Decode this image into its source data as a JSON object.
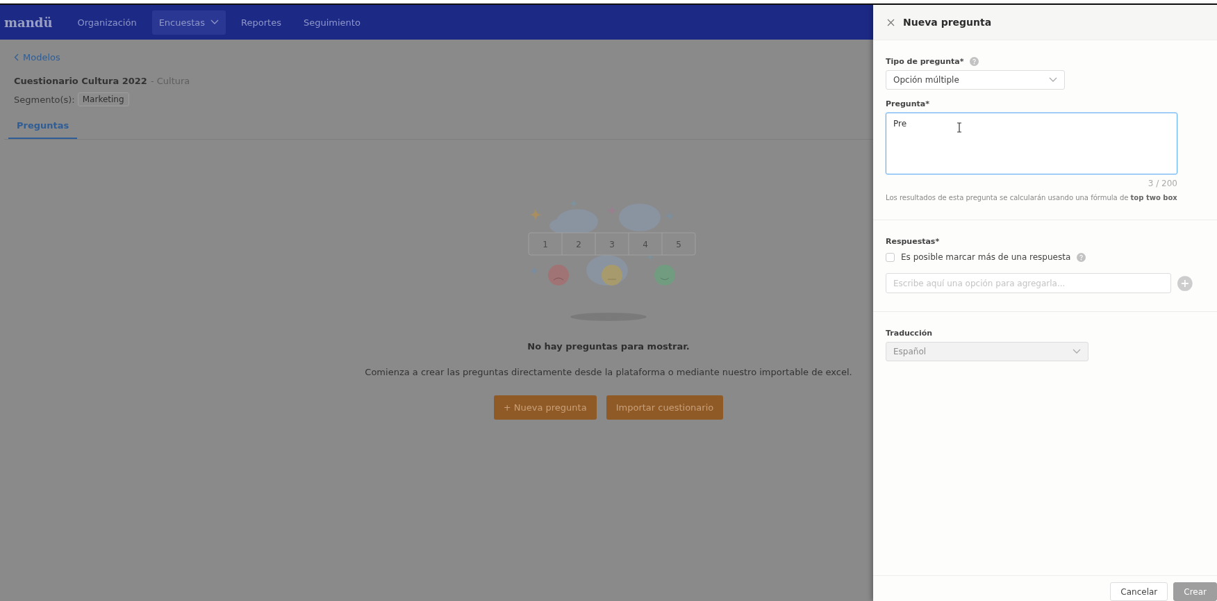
{
  "nav": {
    "logo": "mandü",
    "items": [
      {
        "label": "Organización",
        "kind": "link",
        "selected": false
      },
      {
        "label": "Encuestas",
        "kind": "dropdown",
        "selected": true
      },
      {
        "label": "Reportes",
        "kind": "link",
        "selected": false
      },
      {
        "label": "Seguimiento",
        "kind": "link",
        "selected": false
      }
    ]
  },
  "breadcrumb": "Modelos",
  "survey": {
    "title": "Cuestionario Cultura 2022",
    "category": "- Cultura"
  },
  "segments": {
    "label": "Segmento(s):",
    "tags": [
      "Marketing"
    ]
  },
  "tabs": [
    {
      "label": "Preguntas",
      "selected": true
    }
  ],
  "empty_state": {
    "scale_labels": [
      "1",
      "2",
      "3",
      "4",
      "5"
    ],
    "title": "No hay preguntas para mostrar.",
    "description": "Comienza a crear las preguntas directamente desde la plataforma o mediante nuestro importable de excel.",
    "buttons": [
      {
        "label": "+ Nueva pregunta"
      },
      {
        "label": "Importar cuestionario"
      }
    ]
  },
  "panel": {
    "title": "Nueva pregunta",
    "type_field": {
      "label": "Tipo de pregunta*",
      "value": "Opción múltiple",
      "disabled": false
    },
    "question_field": {
      "label": "Pregunta*",
      "value": "Pre",
      "counter": "3 / 200"
    },
    "note": "Los resultados de esta pregunta se calcularán usando una fórmula de **top two box**",
    "answers": {
      "label": "Respuestas*",
      "multiple": {
        "label": "Es posible marcar más de una respuesta",
        "checked": false
      },
      "placeholder": "Escribe aquí una opción para agregarla..."
    },
    "translation_field": {
      "label": "Traducción",
      "value": "Español",
      "disabled": true
    },
    "buttons": [
      {
        "label": "Cancelar",
        "kind": "secondary",
        "disabled": false
      },
      {
        "label": "Crear",
        "kind": "primary",
        "disabled": true
      }
    ]
  }
}
